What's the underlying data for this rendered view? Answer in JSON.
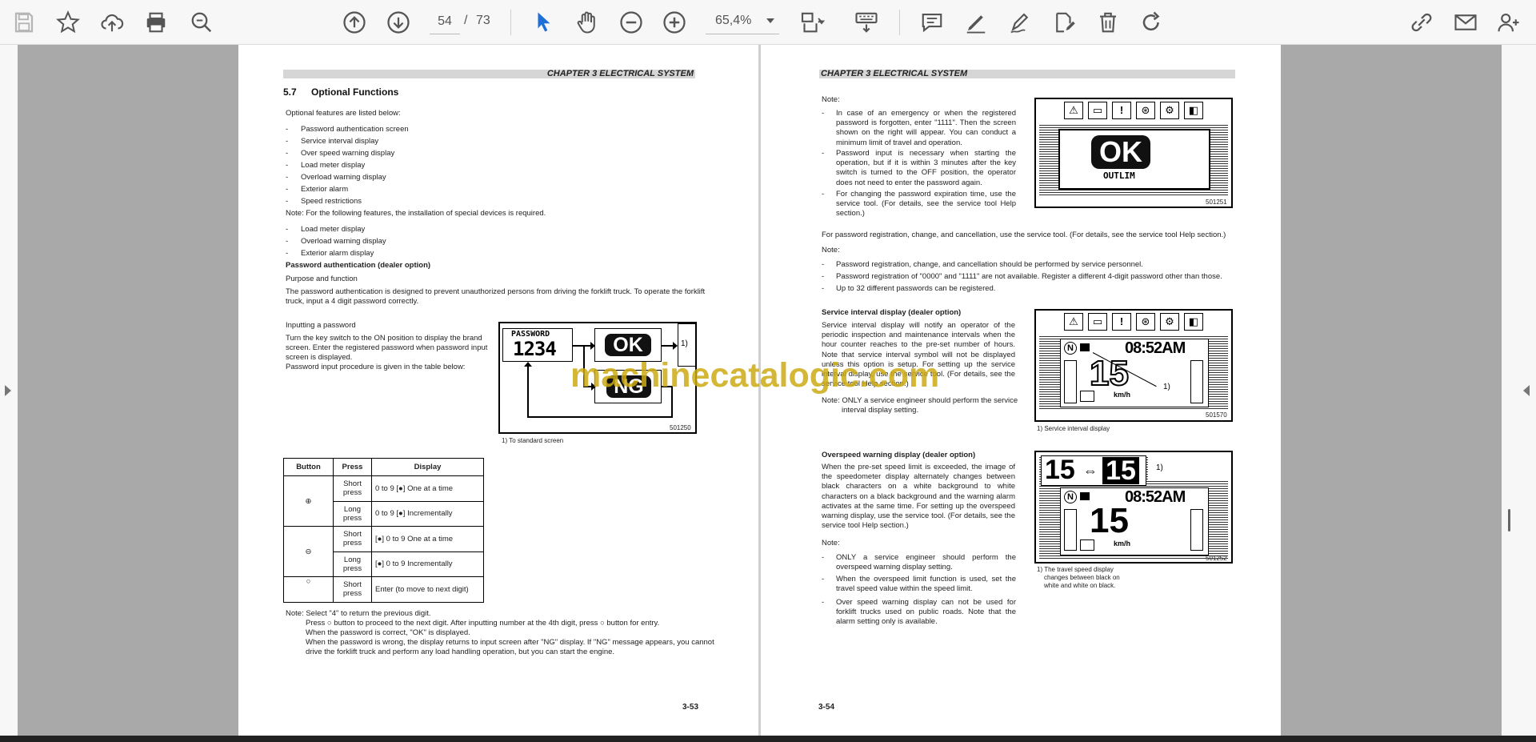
{
  "toolbar": {
    "page_current": "54",
    "page_separator": "/",
    "page_total": "73",
    "zoom_value": "65,4%"
  },
  "watermark": "machinecatalogic.com",
  "left_page": {
    "chapter": "CHAPTER 3 ELECTRICAL SYSTEM",
    "section_num": "5.7",
    "section_title": "Optional Functions",
    "intro": "Optional features are listed below:",
    "features": [
      "Password authentication screen",
      "Service interval display",
      "Over speed warning display",
      "Load meter display",
      "Overload warning display",
      "Exterior alarm",
      "Speed restrictions"
    ],
    "note_special": "Note: For the following features, the installation of special devices is required.",
    "special_features": [
      "Load meter display",
      "Overload warning display",
      "Exterior alarm display"
    ],
    "pw_heading": "Password authentication (dealer option)",
    "purpose_heading": "Purpose and function",
    "purpose_lines": [
      "The password authentication is designed to prevent unauthorized persons from driving the forklift truck. To operate the forklift",
      "truck, input a 4 digit password correctly."
    ],
    "input_heading": "Inputting a password",
    "input_lines": [
      "Turn the key switch to the ON position to display the brand",
      "screen. Enter the registered password when password input",
      "screen is displayed.",
      "Password input procedure is given in the table below:"
    ],
    "diagram": {
      "password_label": "PASSWORD",
      "password_value": "1234",
      "ok": "OK",
      "ng": "NG",
      "callout": "1)",
      "code": "501250",
      "caption": "1) To standard screen"
    },
    "table": {
      "headers": [
        "Button",
        "Press",
        "Display"
      ],
      "rows": [
        {
          "button": "⊕",
          "press": "Short press",
          "display": "0 to 9 [●] One at a time"
        },
        {
          "button": "",
          "press": "Long press",
          "display": "0 to 9 [●] Incrementally"
        },
        {
          "button": "⊖",
          "press": "Short press",
          "display": "[●] 0 to 9 One at a time"
        },
        {
          "button": "",
          "press": "Long press",
          "display": "[●] 0 to 9 Incrementally"
        },
        {
          "button": "○",
          "press": "Short press",
          "display": "Enter (to move to next digit)"
        }
      ]
    },
    "bottom_notes": [
      "Note: Select \"4\" to return the previous digit.",
      "Press ○ button to proceed to the next digit. After inputting number at the 4th digit, press ○ button for entry.",
      "When the password is correct, \"OK\" is displayed.",
      "When the password is wrong, the display returns to input screen after \"NG\" display. If \"NG\" message appears, you cannot",
      "drive the forklift truck and perform any load handling operation, but you can start the engine."
    ],
    "page_number": "3-53"
  },
  "right_page": {
    "chapter": "CHAPTER 3 ELECTRICAL SYSTEM",
    "note_label": "Note:",
    "notes1": [
      "In case of an emergency or when the registered password is forgotten, enter \"1111\". Then the screen shown on the right will appear. You can conduct a minimum limit of travel and operation.",
      "Password input is necessary when starting the operation, but if it is within 3 minutes after the key switch is turned to the OFF position, the operator does not need to enter the password again.",
      "For changing the password expiration time, use the service tool. (For details, see the service tool Help section.)"
    ],
    "fig1": {
      "ok": "OK",
      "sub": "OUTLIM",
      "code": "501251"
    },
    "reg_line": "For password registration, change, and cancellation, use the service tool. (For details, see the service tool Help section.)",
    "note_label2": "Note:",
    "notes2": [
      "Password registration, change, and cancellation should be performed by service personnel.",
      "Password registration of \"0000\" and \"1111\" are not available. Register a different 4-digit password other than those.",
      "Up to 32 different passwords can be registered."
    ],
    "service_heading": "Service interval display (dealer option)",
    "service_text": "Service interval display will notify an operator of the periodic inspection and maintenance intervals when the hour counter reaches to the pre-set number of hours. Note that service interval symbol will not be displayed unless this option is setup. For setting up the service interval display, use the service tool. (For details, see the service tool Help section.)",
    "service_note": "Note: ONLY a service engineer should perform the service",
    "service_note2": "interval display setting.",
    "fig2": {
      "time": "08:52AM",
      "speed": "15",
      "unit": "km/h",
      "gear": "N",
      "callout": "1)",
      "code": "501570",
      "caption": "1) Service interval display"
    },
    "overspeed_heading": "Overspeed warning display (dealer option)",
    "overspeed_text": "When the pre-set speed limit is exceeded, the image of the speedometer display alternately changes between black characters on a white background to white characters on a black background and the warning alarm activates at the same time. For setting up the overspeed warning display, use the service tool. (For details, see the service tool Help section.)",
    "note_label3": "Note:",
    "notes3": [
      "ONLY a service engineer should perform the overspeed warning display setting.",
      "When the overspeed limit function is used, set the travel speed value within the speed limit.",
      "Over speed warning display can not be used for forklift trucks used on public roads. Note that the alarm setting only is available."
    ],
    "fig3": {
      "speed_a": "15",
      "arrow": "⇔",
      "speed_b": "15",
      "callout": "1)",
      "time": "08:52AM",
      "speed": "15",
      "unit": "km/h",
      "gear": "N",
      "code": "501252",
      "caption_lines": [
        "1) The travel speed display",
        "changes between black on",
        "white and white on black."
      ]
    },
    "page_number": "3-54"
  }
}
